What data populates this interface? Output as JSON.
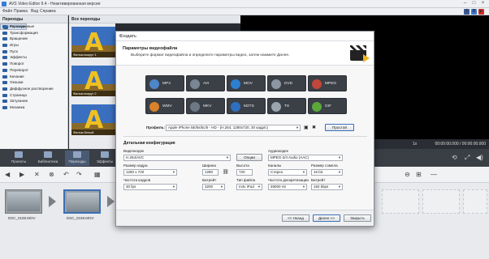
{
  "app": {
    "title": "AVS Video Editor 9.4 - Неактивированная версия"
  },
  "menu": [
    "Файл",
    "Правка",
    "Вид",
    "Справка"
  ],
  "social": [
    "f",
    "B",
    "▶"
  ],
  "left_panel": {
    "header": "Переходы",
    "categories": [
      "Все переходы",
      "Расширенные",
      "Трансформация",
      "Вращение",
      "Игры",
      "Пуск",
      "Эффекты",
      "Поворот",
      "Переворот",
      "Качание",
      "Окошки",
      "Диффузное растворение",
      "Страница",
      "Затухание",
      "Мозаика"
    ]
  },
  "grid_panel": {
    "header": "Все переходы",
    "thumbs": [
      "Фильм вокруг 1",
      "Фильм вокруг 2",
      "Фильм белый"
    ]
  },
  "playbar": {
    "speed": "1x",
    "timecode": "00:00:00.000 / 00:00:00.000"
  },
  "toolbar": {
    "buttons": [
      "Проекты",
      "Библиотека",
      "Переходы",
      "Эффекты",
      "Текст",
      "Голос",
      "Диски",
      "Сохранить"
    ]
  },
  "timeline": {
    "clips": [
      "DSC_0159.MOV",
      "DSC_0159.MOV"
    ]
  },
  "dialog": {
    "title": "Создать",
    "close": "×",
    "heading": "Параметры видеофайла",
    "subheading": "Выберите формат видеофайла и определите параметры видео, затем нажмите Далее.",
    "formats": [
      {
        "label": "MP4",
        "color": "#4e86c8"
      },
      {
        "label": "AVI",
        "color": "#7a8694"
      },
      {
        "label": "MOV",
        "color": "#2d7fd0"
      },
      {
        "label": "DVD",
        "color": "#8c96a3"
      },
      {
        "label": "MPEG",
        "color": "#c2463a"
      },
      {
        "label": "WMV",
        "color": "#d9822b"
      },
      {
        "label": "MKV",
        "color": "#6d7884"
      },
      {
        "label": "M2TS",
        "color": "#2f6fc0"
      },
      {
        "label": "TS",
        "color": "#9aa4ae"
      },
      {
        "label": "GIF",
        "color": "#5aa83a"
      }
    ],
    "profile_label": "Профиль:",
    "profile_value": "Apple iPhone 5E/5s/5c/5 - HD - (H.264, 1280x720, 30 кадр/с)",
    "profile_button": "Простой",
    "detail_heading": "Детальная конфигурация",
    "video_codec_label": "Видеокодек",
    "video_codec": "H.264/AVC",
    "options_button": "Опции",
    "audio_codec_label": "Аудиокодек",
    "audio_codec": "MPEG-2/4 Audio (AAC)",
    "frame_size_label": "Размер кадра",
    "frame_size": "1280 x 720",
    "width_label": "Ширина",
    "width": "1280",
    "height_label": "Высота",
    "height": "720",
    "channels_label": "Каналы",
    "channels": "Стерео",
    "sample_size_label": "Размер сэмпла",
    "sample_size": "16 bit",
    "frame_rate_label": "Частота кадров",
    "frame_rate": "30 fps",
    "bitrate_label": "Битрейт",
    "bitrate": "3200",
    "file_type_label": "Тип файла",
    "file_type": "m4v iPod",
    "sampling_rate_label": "Частота дискретизации",
    "sampling_rate": "48000 Hz",
    "audio_bitrate_label": "Битрейт",
    "audio_bitrate": "192 kbps",
    "back_button": "<< Назад",
    "next_button": "Далее >>",
    "close_button": "Закрыть"
  }
}
